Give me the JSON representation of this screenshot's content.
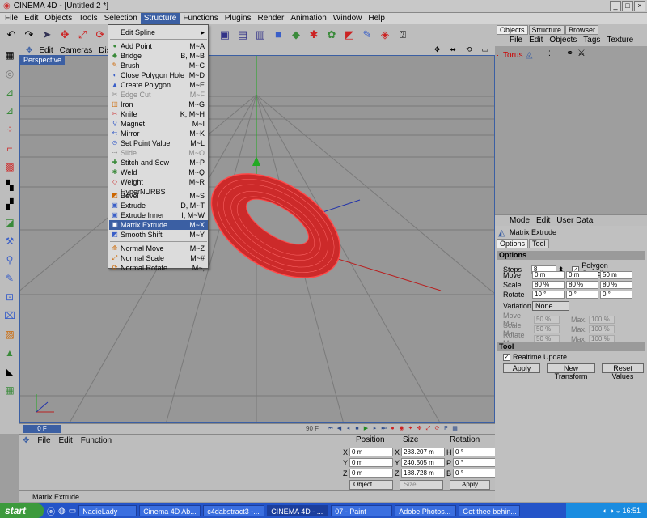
{
  "window": {
    "title": "CINEMA 4D - [Untitled 2 *]",
    "controls": [
      "_",
      "□",
      "×"
    ]
  },
  "menubar": [
    "File",
    "Edit",
    "Objects",
    "Tools",
    "Selection",
    "Structure",
    "Functions",
    "Plugins",
    "Render",
    "Animation",
    "Window",
    "Help"
  ],
  "viewport": {
    "menu": [
      "Edit",
      "Cameras",
      "Display",
      "Vi"
    ],
    "label": "Perspective",
    "nav_icons": [
      "✥",
      "⬌",
      "⟲",
      "▭"
    ]
  },
  "structure_menu": {
    "items": [
      {
        "label": "Edit Spline",
        "shortcut": "▸",
        "disabled": false,
        "sep_after": true
      },
      {
        "label": "Add Point",
        "shortcut": "M~A",
        "disabled": false
      },
      {
        "label": "Bridge",
        "shortcut": "B, M~B",
        "disabled": false
      },
      {
        "label": "Brush",
        "shortcut": "M~C",
        "disabled": false
      },
      {
        "label": "Close Polygon Hole",
        "shortcut": "M~D",
        "disabled": false
      },
      {
        "label": "Create Polygon",
        "shortcut": "M~E",
        "disabled": false
      },
      {
        "label": "Edge Cut",
        "shortcut": "M~F",
        "disabled": true
      },
      {
        "label": "Iron",
        "shortcut": "M~G",
        "disabled": false
      },
      {
        "label": "Knife",
        "shortcut": "K, M~H",
        "disabled": false
      },
      {
        "label": "Magnet",
        "shortcut": "M~I",
        "disabled": false
      },
      {
        "label": "Mirror",
        "shortcut": "M~K",
        "disabled": false
      },
      {
        "label": "Set Point Value",
        "shortcut": "M~L",
        "disabled": false
      },
      {
        "label": "Slide",
        "shortcut": "M~O",
        "disabled": true
      },
      {
        "label": "Stitch and Sew",
        "shortcut": "M~P",
        "disabled": false
      },
      {
        "label": "Weld",
        "shortcut": "M~Q",
        "disabled": false
      },
      {
        "label": "Weight HyperNURBS",
        "shortcut": "M~R",
        "disabled": false,
        "sep_after": true
      },
      {
        "label": "Bevel",
        "shortcut": "M~S",
        "disabled": false
      },
      {
        "label": "Extrude",
        "shortcut": "D, M~T",
        "disabled": false
      },
      {
        "label": "Extrude Inner",
        "shortcut": "I, M~W",
        "disabled": false
      },
      {
        "label": "Matrix Extrude",
        "shortcut": "M~X",
        "disabled": false,
        "highlight": true
      },
      {
        "label": "Smooth Shift",
        "shortcut": "M~Y",
        "disabled": false,
        "sep_after": true
      },
      {
        "label": "Normal Move",
        "shortcut": "M~Z",
        "disabled": false
      },
      {
        "label": "Normal Scale",
        "shortcut": "M~#",
        "disabled": false
      },
      {
        "label": "Normal Rotate",
        "shortcut": "M~,",
        "disabled": false
      }
    ]
  },
  "timeline": {
    "start": "0 F",
    "end": "90 F"
  },
  "material_menu": [
    "File",
    "Edit",
    "Function"
  ],
  "coords": {
    "headers": [
      "Position",
      "Size",
      "Rotation"
    ],
    "rows": [
      {
        "axis": "X",
        "pos": "0 m",
        "size_axis": "X",
        "size": "283.207 m",
        "rot_axis": "H",
        "rot": "0 °"
      },
      {
        "axis": "Y",
        "pos": "0 m",
        "size_axis": "Y",
        "size": "240.505 m",
        "rot_axis": "P",
        "rot": "0 °"
      },
      {
        "axis": "Z",
        "pos": "0 m",
        "size_axis": "Z",
        "size": "188.728 m",
        "rot_axis": "B",
        "rot": "0 °"
      }
    ],
    "mode": "Object",
    "size_mode": "Size",
    "apply": "Apply"
  },
  "status": "Matrix Extrude",
  "object_tabs": [
    "Objects",
    "Structure",
    "Browser"
  ],
  "object_menu": [
    "File",
    "Edit",
    "Objects",
    "Tags",
    "Texture"
  ],
  "object_list": [
    {
      "name": "Torus"
    }
  ],
  "attr_menu": [
    "Mode",
    "Edit",
    "User Data"
  ],
  "attributes": {
    "title": "Matrix Extrude",
    "tabs": [
      "Options",
      "Tool"
    ],
    "options_header": "Options",
    "steps_label": "Steps",
    "steps": "8",
    "polycoord_label": "Polygon Coordinates",
    "move_label": "Move",
    "move": [
      "0 m",
      "0 m",
      "50 m"
    ],
    "scale_label": "Scale",
    "scale": [
      "80 %",
      "80 %",
      "80 %"
    ],
    "rotate_label": "Rotate",
    "rotate": [
      "10 °",
      "0 °",
      "0 °"
    ],
    "variation_label": "Variation",
    "variation": "None",
    "dis_rows": [
      {
        "label": "Move Min.",
        "min": "50 %",
        "maxlabel": "Max.",
        "max": "100 %"
      },
      {
        "label": "Scale Min.",
        "min": "50 %",
        "maxlabel": "Max.",
        "max": "100 %"
      },
      {
        "label": "Rotate Min.",
        "min": "50 %",
        "maxlabel": "Max.",
        "max": "100 %"
      }
    ],
    "tool_header": "Tool",
    "realtime_label": "Realtime Update",
    "buttons": [
      "Apply",
      "New Transform",
      "Reset Values"
    ]
  },
  "taskbar": {
    "start": "start",
    "tasks": [
      "NadieLady",
      "Cinema 4D Ab...",
      "c4dabstract3 -...",
      "CINEMA 4D - ...",
      "07 - Paint",
      "Adobe Photos...",
      "Get thee behin..."
    ],
    "clock": "16:51"
  }
}
